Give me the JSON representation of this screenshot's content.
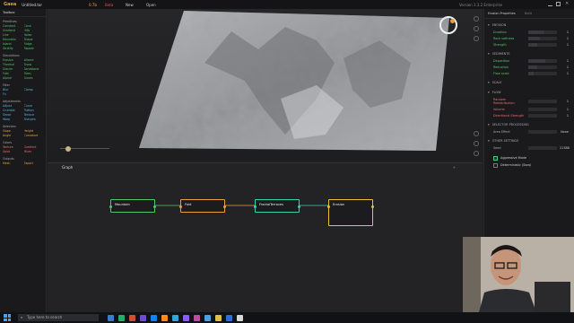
{
  "app": {
    "name": "Gaea",
    "file_name": "Untitled.tor",
    "version": "0.7b",
    "badge": "Beta",
    "menu_new": "New",
    "menu_open": "Open",
    "status_right": "Version 1.3.2 Enterprise"
  },
  "toolbox": {
    "title": "Toolbox",
    "groups": [
      {
        "title": "Primitives",
        "color": "#4fc76d",
        "items": [
          "Constant",
          "Cone",
          "Gradient",
          "Hills",
          "Line",
          "Noise",
          "Mountain",
          "Shape",
          "Island",
          "Ridge",
          "Stratify",
          "Repeat"
        ]
      },
      {
        "title": "Simulations",
        "color": "#4fc76d",
        "items": [
          "Erosion",
          "Wizard",
          "Thermal",
          "Snow",
          "Glacier",
          "Sandstone",
          "Fold",
          "Trees",
          "Alpine",
          "Dunes"
        ]
      },
      {
        "title": "Filter",
        "color": "#58b7e8",
        "items": [
          "Blur",
          "Clamp",
          "Fx"
        ]
      },
      {
        "title": "Adjustments",
        "color": "#58b7e8",
        "items": [
          "Adjust",
          "Curve",
          "Crumble",
          "Flatten",
          "Shear",
          "Terrace",
          "Warp",
          "Sharpen"
        ]
      },
      {
        "title": "Selectors",
        "color": "#e8a23a",
        "items": [
          "Slope",
          "Height",
          "Angle",
          "Curvature"
        ]
      },
      {
        "title": "Colors",
        "color": "#e86f6f",
        "items": [
          "Texture",
          "Gradient",
          "Splat",
          "Mixer"
        ]
      },
      {
        "title": "Outputs",
        "color": "#e8a23a",
        "items": [
          "Mesh",
          "Export"
        ]
      }
    ]
  },
  "graph": {
    "title": "Graph",
    "nodes": [
      {
        "label": "Mountain",
        "color": "#4fc76d"
      },
      {
        "label": "Fold",
        "color": "#e8a23a"
      },
      {
        "label": "FractalTerraces",
        "color": "#36d1b0"
      },
      {
        "label": "Erosion",
        "color": "#e8c23a"
      }
    ]
  },
  "props": {
    "tab_props": "Erosion Properties",
    "tab_build": "Build",
    "sections": [
      {
        "title": "EROSION",
        "rows": [
          {
            "label": "Duration",
            "value": "1",
            "fill": 0.55
          },
          {
            "label": "Rock softness",
            "value": "1",
            "fill": 0.4
          },
          {
            "label": "Strength",
            "value": "1",
            "fill": 0.3
          }
        ]
      },
      {
        "title": "SEDIMENTS",
        "rows": [
          {
            "label": "Deposition",
            "value": "1",
            "fill": 0.6
          },
          {
            "label": "Reduction",
            "value": "1",
            "fill": 0.3
          },
          {
            "label": "Flow scale",
            "value": "1",
            "fill": 0.2
          }
        ]
      },
      {
        "title": "SCALE",
        "rows": []
      },
      {
        "title": "FLOW",
        "rows": [
          {
            "label": "Random Redistribution",
            "value": "1",
            "fill": 0.0
          },
          {
            "label": "Volume",
            "value": "1",
            "fill": 0.0
          },
          {
            "label": "Directional Strength",
            "value": "1",
            "fill": 0.0
          }
        ]
      },
      {
        "title": "SELECTOR PROCESSING",
        "rows": [
          {
            "label": "Area Effect",
            "value": "None",
            "fill": 0.0
          }
        ]
      },
      {
        "title": "OTHER SETTINGS",
        "rows": [
          {
            "label": "Seed",
            "value": "21388",
            "fill": 0.0
          }
        ]
      }
    ],
    "checkbox_1": "Aggressive Mode",
    "checkbox_2": "Deterministic (Slow)"
  },
  "taskbar": {
    "search_placeholder": "Type here to search",
    "icon_colors": [
      "#3a7bd5",
      "#2ba86b",
      "#d24b3b",
      "#6f4cc9",
      "#0a84ff",
      "#ff8a1e",
      "#2fa6d8",
      "#8a5cf0",
      "#c44a9b",
      "#4aa0e0",
      "#e0c040",
      "#2a6fd6",
      "#d8d8d8"
    ]
  }
}
